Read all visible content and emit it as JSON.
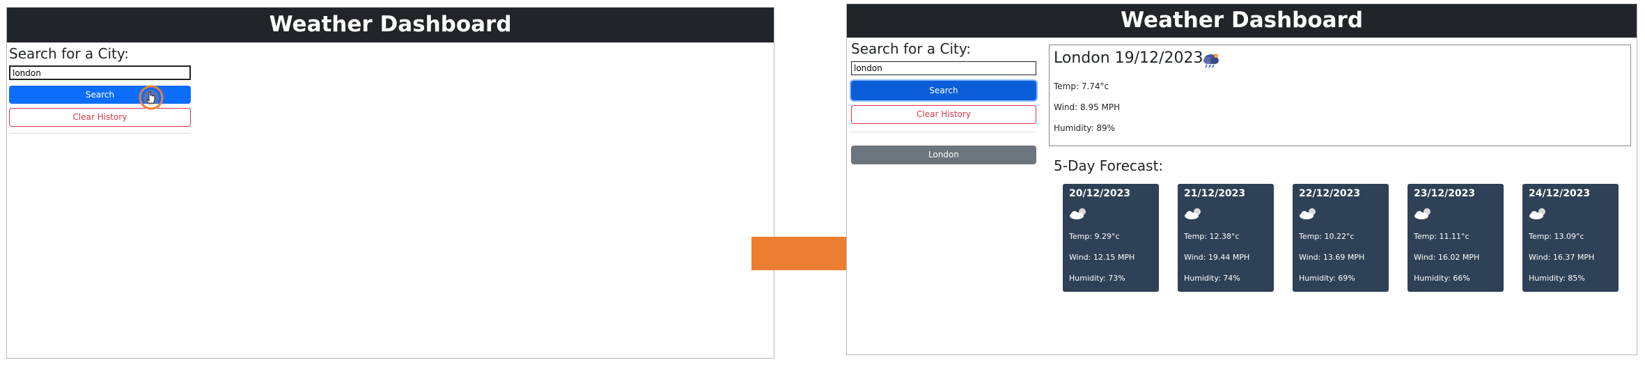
{
  "app": {
    "title": "Weather Dashboard"
  },
  "before": {
    "search_heading": "Search for a City:",
    "input_value": "london",
    "search_label": "Search",
    "clear_label": "Clear History"
  },
  "after": {
    "search_heading": "Search for a City:",
    "input_value": "london",
    "search_label": "Search",
    "clear_label": "Clear History",
    "history": [
      "London"
    ],
    "current": {
      "title": "London 19/12/2023",
      "icon": "rain-cloud-icon",
      "temp": "Temp: 7.74°c",
      "wind": "Wind: 8.95 MPH",
      "humidity": "Humidity: 89%"
    },
    "forecast_heading": "5-Day Forecast:",
    "forecast": [
      {
        "date": "20/12/2023",
        "icon": "partly-cloudy-icon",
        "temp": "Temp: 9.29°c",
        "wind": "Wind: 12.15 MPH",
        "humidity": "Humidity: 73%"
      },
      {
        "date": "21/12/2023",
        "icon": "partly-cloudy-icon",
        "temp": "Temp: 12.38°c",
        "wind": "Wind: 19.44 MPH",
        "humidity": "Humidity: 74%"
      },
      {
        "date": "22/12/2023",
        "icon": "partly-cloudy-icon",
        "temp": "Temp: 10.22°c",
        "wind": "Wind: 13.69 MPH",
        "humidity": "Humidity: 69%"
      },
      {
        "date": "23/12/2023",
        "icon": "partly-cloudy-icon",
        "temp": "Temp: 11.11°c",
        "wind": "Wind: 16.02 MPH",
        "humidity": "Humidity: 66%"
      },
      {
        "date": "24/12/2023",
        "icon": "partly-cloudy-icon",
        "temp": "Temp: 13.09°c",
        "wind": "Wind: 16.37 MPH",
        "humidity": "Humidity: 85%"
      }
    ]
  },
  "colors": {
    "header_bg": "#212529",
    "primary": "#0d6efd",
    "danger": "#dc3545",
    "secondary": "#6c757d",
    "card_bg": "#2f4156",
    "arrow": "#ed7d31"
  }
}
